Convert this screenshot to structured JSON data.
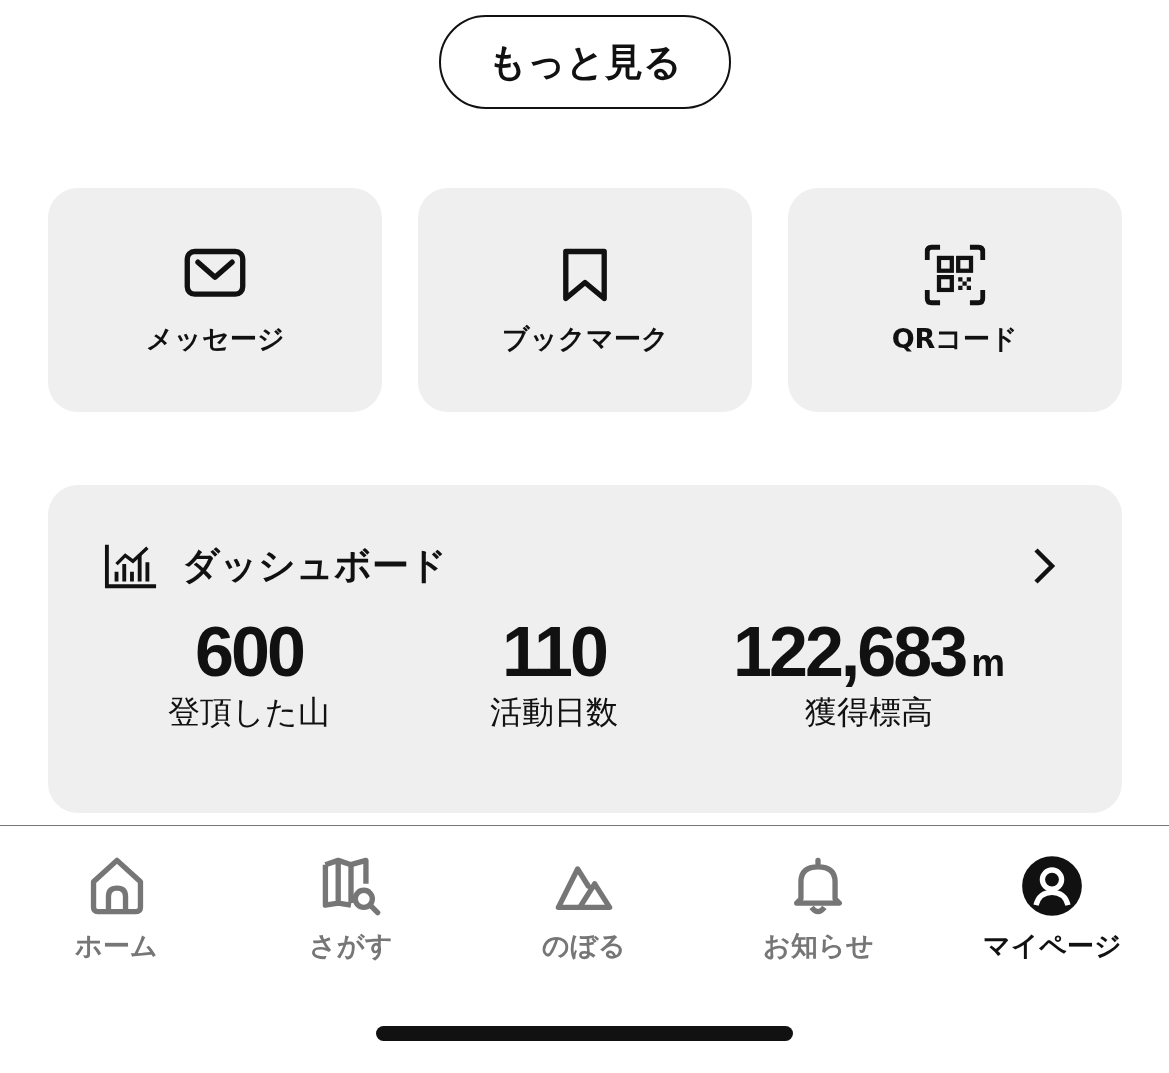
{
  "more_button": "もっと見る",
  "shortcuts": [
    {
      "kind": "mail",
      "label": "メッセージ"
    },
    {
      "kind": "bookmark",
      "label": "ブックマーク"
    },
    {
      "kind": "qr",
      "label": "QRコード"
    }
  ],
  "dashboard": {
    "title": "ダッシュボード",
    "stats": [
      {
        "value": "600",
        "label": "登頂した山"
      },
      {
        "value": "110",
        "label": "活動日数"
      },
      {
        "value": "122,683",
        "unit": "m",
        "label": "獲得標高"
      }
    ]
  },
  "tab_bar": [
    {
      "kind": "home",
      "label": "ホーム",
      "selected": false
    },
    {
      "kind": "map",
      "label": "さがす",
      "selected": false
    },
    {
      "kind": "mountain",
      "label": "のぼる",
      "selected": false
    },
    {
      "kind": "bell",
      "label": "お知らせ",
      "selected": false
    },
    {
      "kind": "person",
      "label": "マイページ",
      "selected": true
    }
  ]
}
